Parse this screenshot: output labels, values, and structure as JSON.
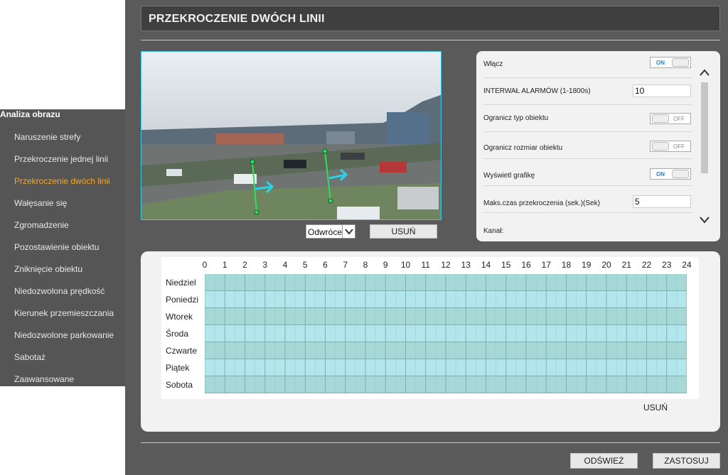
{
  "sidebar": {
    "header": "Analiza obrazu",
    "items": [
      {
        "label": "Naruszenie strefy",
        "active": false
      },
      {
        "label": "Przekroczenie jednej linii",
        "active": false
      },
      {
        "label": "Przekroczenie dwóch linii",
        "active": true
      },
      {
        "label": "Wałęsanie się",
        "active": false
      },
      {
        "label": "Zgromadzenie",
        "active": false
      },
      {
        "label": "Pozostawienie obiektu",
        "active": false
      },
      {
        "label": "Zniknięcie obiektu",
        "active": false
      },
      {
        "label": "Niedozwolona prędkość",
        "active": false
      },
      {
        "label": "Kierunek przemieszczania",
        "active": false
      },
      {
        "label": "Niedozwolone parkowanie",
        "active": false
      },
      {
        "label": "Sabotaż",
        "active": false
      },
      {
        "label": "Zaawansowane",
        "active": false
      }
    ]
  },
  "page": {
    "title": "PRZEKROCZENIE DWÓCH LINII"
  },
  "video": {
    "direction_select": "Odwróce",
    "clear_button": "USUŃ",
    "line_color": "#2ee05a",
    "arrow_color": "#29d3e6"
  },
  "settings": {
    "enable_label": "Włącz",
    "enable_state": "ON",
    "interval_label": "INTERWAŁ ALARMÓW (1-1800s)",
    "interval_value": "10",
    "limit_type_label": "Ogranicz typ obiektu",
    "limit_type_state": "OFF",
    "limit_size_label": "Ogranicz rozmiar obiektu",
    "limit_size_state": "OFF",
    "show_graphics_label": "Wyświetl grafikę",
    "show_graphics_state": "ON",
    "max_time_label": "Maks.czas przekroczenia (sek.)(Sek)",
    "max_time_value": "5",
    "channel_label": "Kanał:"
  },
  "schedule": {
    "hours": [
      "0",
      "1",
      "2",
      "3",
      "4",
      "5",
      "6",
      "7",
      "8",
      "9",
      "10",
      "11",
      "12",
      "13",
      "14",
      "15",
      "16",
      "17",
      "18",
      "19",
      "20",
      "21",
      "22",
      "23",
      "24"
    ],
    "days": [
      "Niedziel",
      "Poniedzi",
      "Wtorek",
      "Środa",
      "Czwarte",
      "Piątek",
      "Sobota"
    ],
    "clear_button": "USUŃ",
    "cell_color_a": "#a6d8d8",
    "cell_color_b": "#b0e6ec"
  },
  "footer": {
    "refresh_button": "ODŚWIEŻ",
    "apply_button": "ZASTOSUJ"
  }
}
